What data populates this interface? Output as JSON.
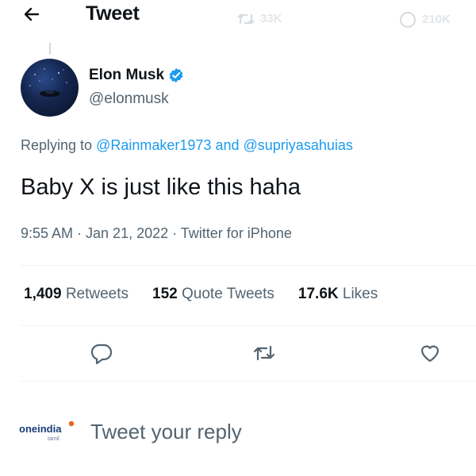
{
  "header": {
    "title": "Tweet",
    "ghost_retweets": "33K",
    "ghost_likes": "210K"
  },
  "author": {
    "name": "Elon Musk",
    "handle": "@elonmusk",
    "verified": true
  },
  "replying": {
    "prefix": "Replying to",
    "user1": "@Rainmaker1973",
    "conj": "and",
    "user2": "@supriyasahuias"
  },
  "tweet": {
    "text": "Baby X is just like this haha",
    "meta": "9:55 AM · Jan 21, 2022 · Twitter for iPhone"
  },
  "stats": {
    "retweets_count": "1,409",
    "retweets_label": "Retweets",
    "quotes_count": "152",
    "quotes_label": "Quote Tweets",
    "likes_count": "17.6K",
    "likes_label": "Likes"
  },
  "reply": {
    "placeholder": "Tweet your reply"
  },
  "watermark": {
    "brand": "oneindia",
    "sub": "tamil"
  },
  "colors": {
    "accent": "#1d9bf0",
    "text": "#0f1419",
    "secondary": "#536471",
    "divider": "#eff3f4"
  },
  "icons": [
    "back-arrow-icon",
    "verified-badge-icon",
    "reply-icon",
    "retweet-icon",
    "like-icon"
  ]
}
